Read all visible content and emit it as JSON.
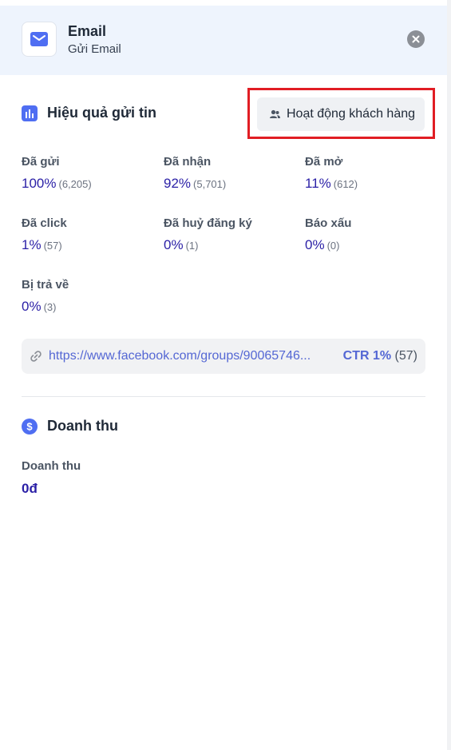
{
  "header": {
    "title": "Email",
    "subtitle": "Gửi Email",
    "icon": "mail-icon",
    "close_icon": "close-icon"
  },
  "performance": {
    "title": "Hiệu quả gửi tin",
    "icon": "bar-chart-icon",
    "activity_button": {
      "label": "Hoạt động khách hàng",
      "icon": "users-icon"
    },
    "stats": [
      {
        "label": "Đã gửi",
        "percent": "100%",
        "count": "(6,205)"
      },
      {
        "label": "Đã nhận",
        "percent": "92%",
        "count": "(5,701)"
      },
      {
        "label": "Đã mở",
        "percent": "11%",
        "count": "(612)"
      },
      {
        "label": "Đã click",
        "percent": "1%",
        "count": "(57)"
      },
      {
        "label": "Đã huỷ đăng ký",
        "percent": "0%",
        "count": "(1)"
      },
      {
        "label": "Báo xấu",
        "percent": "0%",
        "count": "(0)"
      },
      {
        "label": "Bị trả về",
        "percent": "0%",
        "count": "(3)"
      }
    ],
    "link": {
      "url": "https://www.facebook.com/groups/90065746...",
      "ctr_label": "CTR 1%",
      "ctr_count": "(57)",
      "icon": "link-icon"
    }
  },
  "revenue": {
    "title": "Doanh thu",
    "icon": "dollar-icon",
    "label": "Doanh thu",
    "value": "0đ"
  },
  "colors": {
    "accent": "#2a1fa6",
    "link": "#5467d4",
    "header_bg": "#eef4fd",
    "highlight": "#e11d24"
  }
}
